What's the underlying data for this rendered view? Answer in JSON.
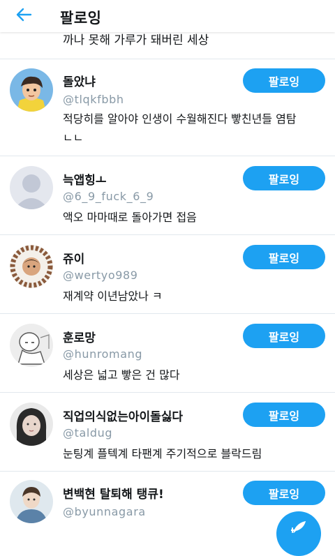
{
  "header": {
    "title": "팔로잉",
    "back_icon": "arrow-left-icon"
  },
  "colors": {
    "accent": "#1da1f2",
    "handle": "#8899a6",
    "divider": "#e1e8ed"
  },
  "partial_row": {
    "bio_fragment": "까나 못해 가루가 돼버린 세상"
  },
  "users": [
    {
      "name": "돌았냐",
      "handle": "@tlqkfbbh",
      "bio": "적당히를 알아야 인생이 수월해진다 빻친년들 염탐ㄴㄴ",
      "button": "팔로잉"
    },
    {
      "name": "늑앱힝ㅗ",
      "handle": "@6_9_fuck_6_9",
      "bio": "액오 마마때로 돌아가면 접음",
      "button": "팔로잉"
    },
    {
      "name": "쥬이",
      "handle": "@wertyo989",
      "bio": "재계약 이년남았나 ㅋ",
      "button": "팔로잉"
    },
    {
      "name": "훈로망",
      "handle": "@hunromang",
      "bio": "세상은 넓고 빻은 건 많다",
      "button": "팔로잉"
    },
    {
      "name": "직업의식없는아이돌싫다",
      "handle": "@taldug",
      "bio": "눈팅계 플텍계 타팬계 주기적으로 블락드림",
      "button": "팔로잉"
    },
    {
      "name": "변백현 탈퇴해 탱큐!",
      "handle": "@byunnagara",
      "bio": "",
      "button": "팔로잉"
    }
  ],
  "fab_icon": "compose-feather-icon"
}
